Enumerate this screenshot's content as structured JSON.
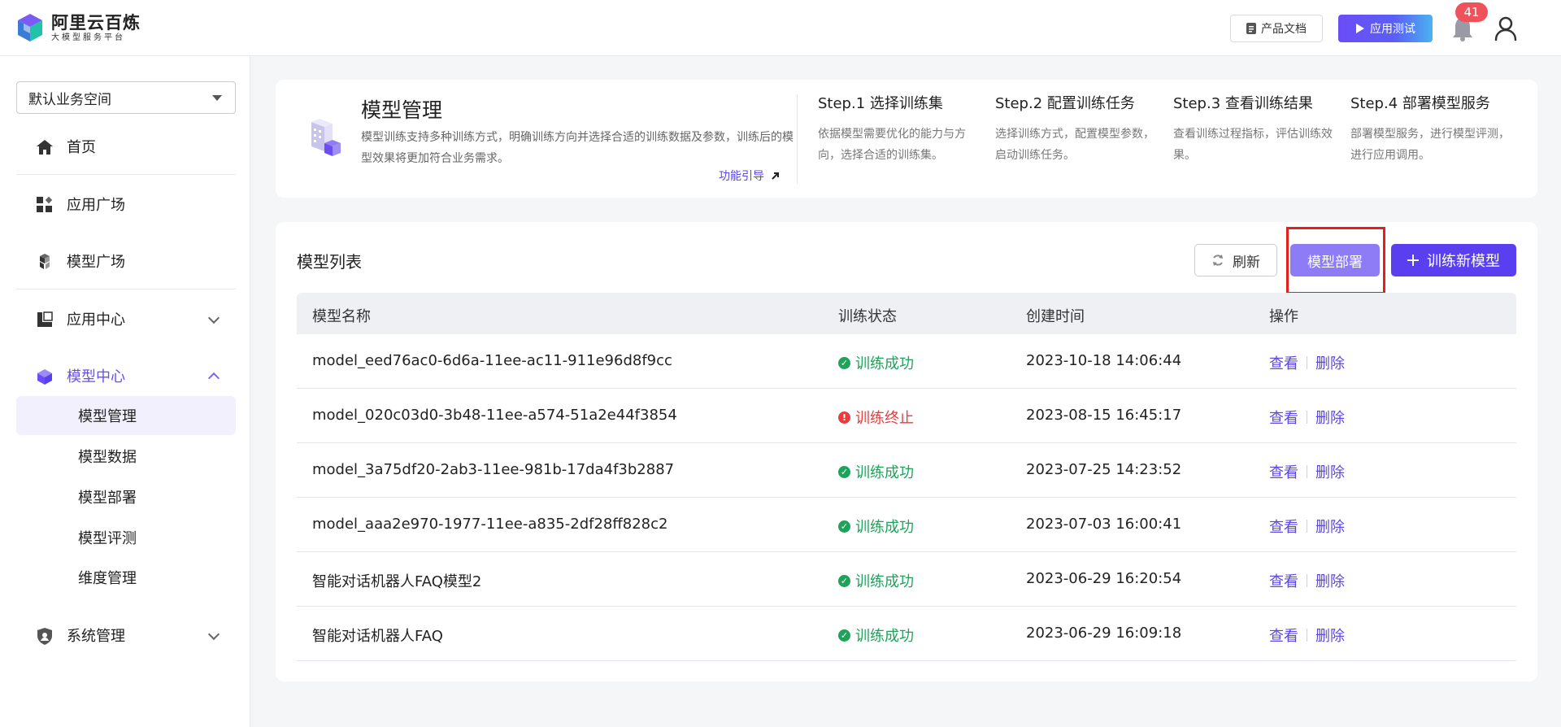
{
  "header": {
    "logo_title": "阿里云百炼",
    "logo_subtitle": "大模型服务平台",
    "doc_label": "产品文档",
    "test_label": "应用测试",
    "notification_count": "41"
  },
  "sidebar": {
    "workspace": "默认业务空间",
    "items": [
      {
        "label": "首页",
        "icon": "home-icon"
      },
      {
        "label": "应用广场",
        "icon": "apps-grid-icon"
      },
      {
        "label": "模型广场",
        "icon": "cubes-icon"
      },
      {
        "label": "应用中心",
        "icon": "app-center-icon"
      },
      {
        "label": "模型中心",
        "icon": "model-cube-icon"
      },
      {
        "label": "系统管理",
        "icon": "shield-icon"
      }
    ],
    "model_center_children": [
      "模型管理",
      "模型数据",
      "模型部署",
      "模型评测",
      "维度管理"
    ]
  },
  "intro": {
    "title": "模型管理",
    "description": "模型训练支持多种训练方式，明确训练方向并选择合适的训练数据及参数，训练后的模型效果将更加符合业务需求。",
    "guide_label": "功能引导",
    "steps": [
      {
        "title": "Step.1 选择训练集",
        "desc": "依据模型需要优化的能力与方向，选择合适的训练集。"
      },
      {
        "title": "Step.2 配置训练任务",
        "desc": "选择训练方式，配置模型参数，启动训练任务。"
      },
      {
        "title": "Step.3 查看训练结果",
        "desc": "查看训练过程指标，评估训练效果。"
      },
      {
        "title": "Step.4 部署模型服务",
        "desc": "部署模型服务，进行模型评测，进行应用调用。"
      }
    ]
  },
  "list": {
    "title": "模型列表",
    "refresh_label": "刷新",
    "deploy_label": "模型部署",
    "train_label": "训练新模型",
    "columns": [
      "模型名称",
      "训练状态",
      "创建时间",
      "操作"
    ],
    "rows": [
      {
        "name": "model_eed76ac0-6d6a-11ee-ac11-911e96d8f9cc",
        "status": "训练成功",
        "status_type": "ok",
        "created": "2023-10-18 14:06:44"
      },
      {
        "name": "model_020c03d0-3b48-11ee-a574-51a2e44f3854",
        "status": "训练终止",
        "status_type": "err",
        "created": "2023-08-15 16:45:17"
      },
      {
        "name": "model_3a75df20-2ab3-11ee-981b-17da4f3b2887",
        "status": "训练成功",
        "status_type": "ok",
        "created": "2023-07-25 14:23:52"
      },
      {
        "name": "model_aaa2e970-1977-11ee-a835-2df28ff828c2",
        "status": "训练成功",
        "status_type": "ok",
        "created": "2023-07-03 16:00:41"
      },
      {
        "name": "智能对话机器人FAQ模型2",
        "status": "训练成功",
        "status_type": "ok",
        "created": "2023-06-29 16:20:54"
      },
      {
        "name": "智能对话机器人FAQ",
        "status": "训练成功",
        "status_type": "ok",
        "created": "2023-06-29 16:09:18"
      }
    ],
    "view_label": "查看",
    "delete_label": "删除"
  },
  "colors": {
    "accent": "#5a3ff0",
    "success": "#1ea35b",
    "error": "#ea3c3c",
    "highlight_box": "#e61e1e"
  }
}
